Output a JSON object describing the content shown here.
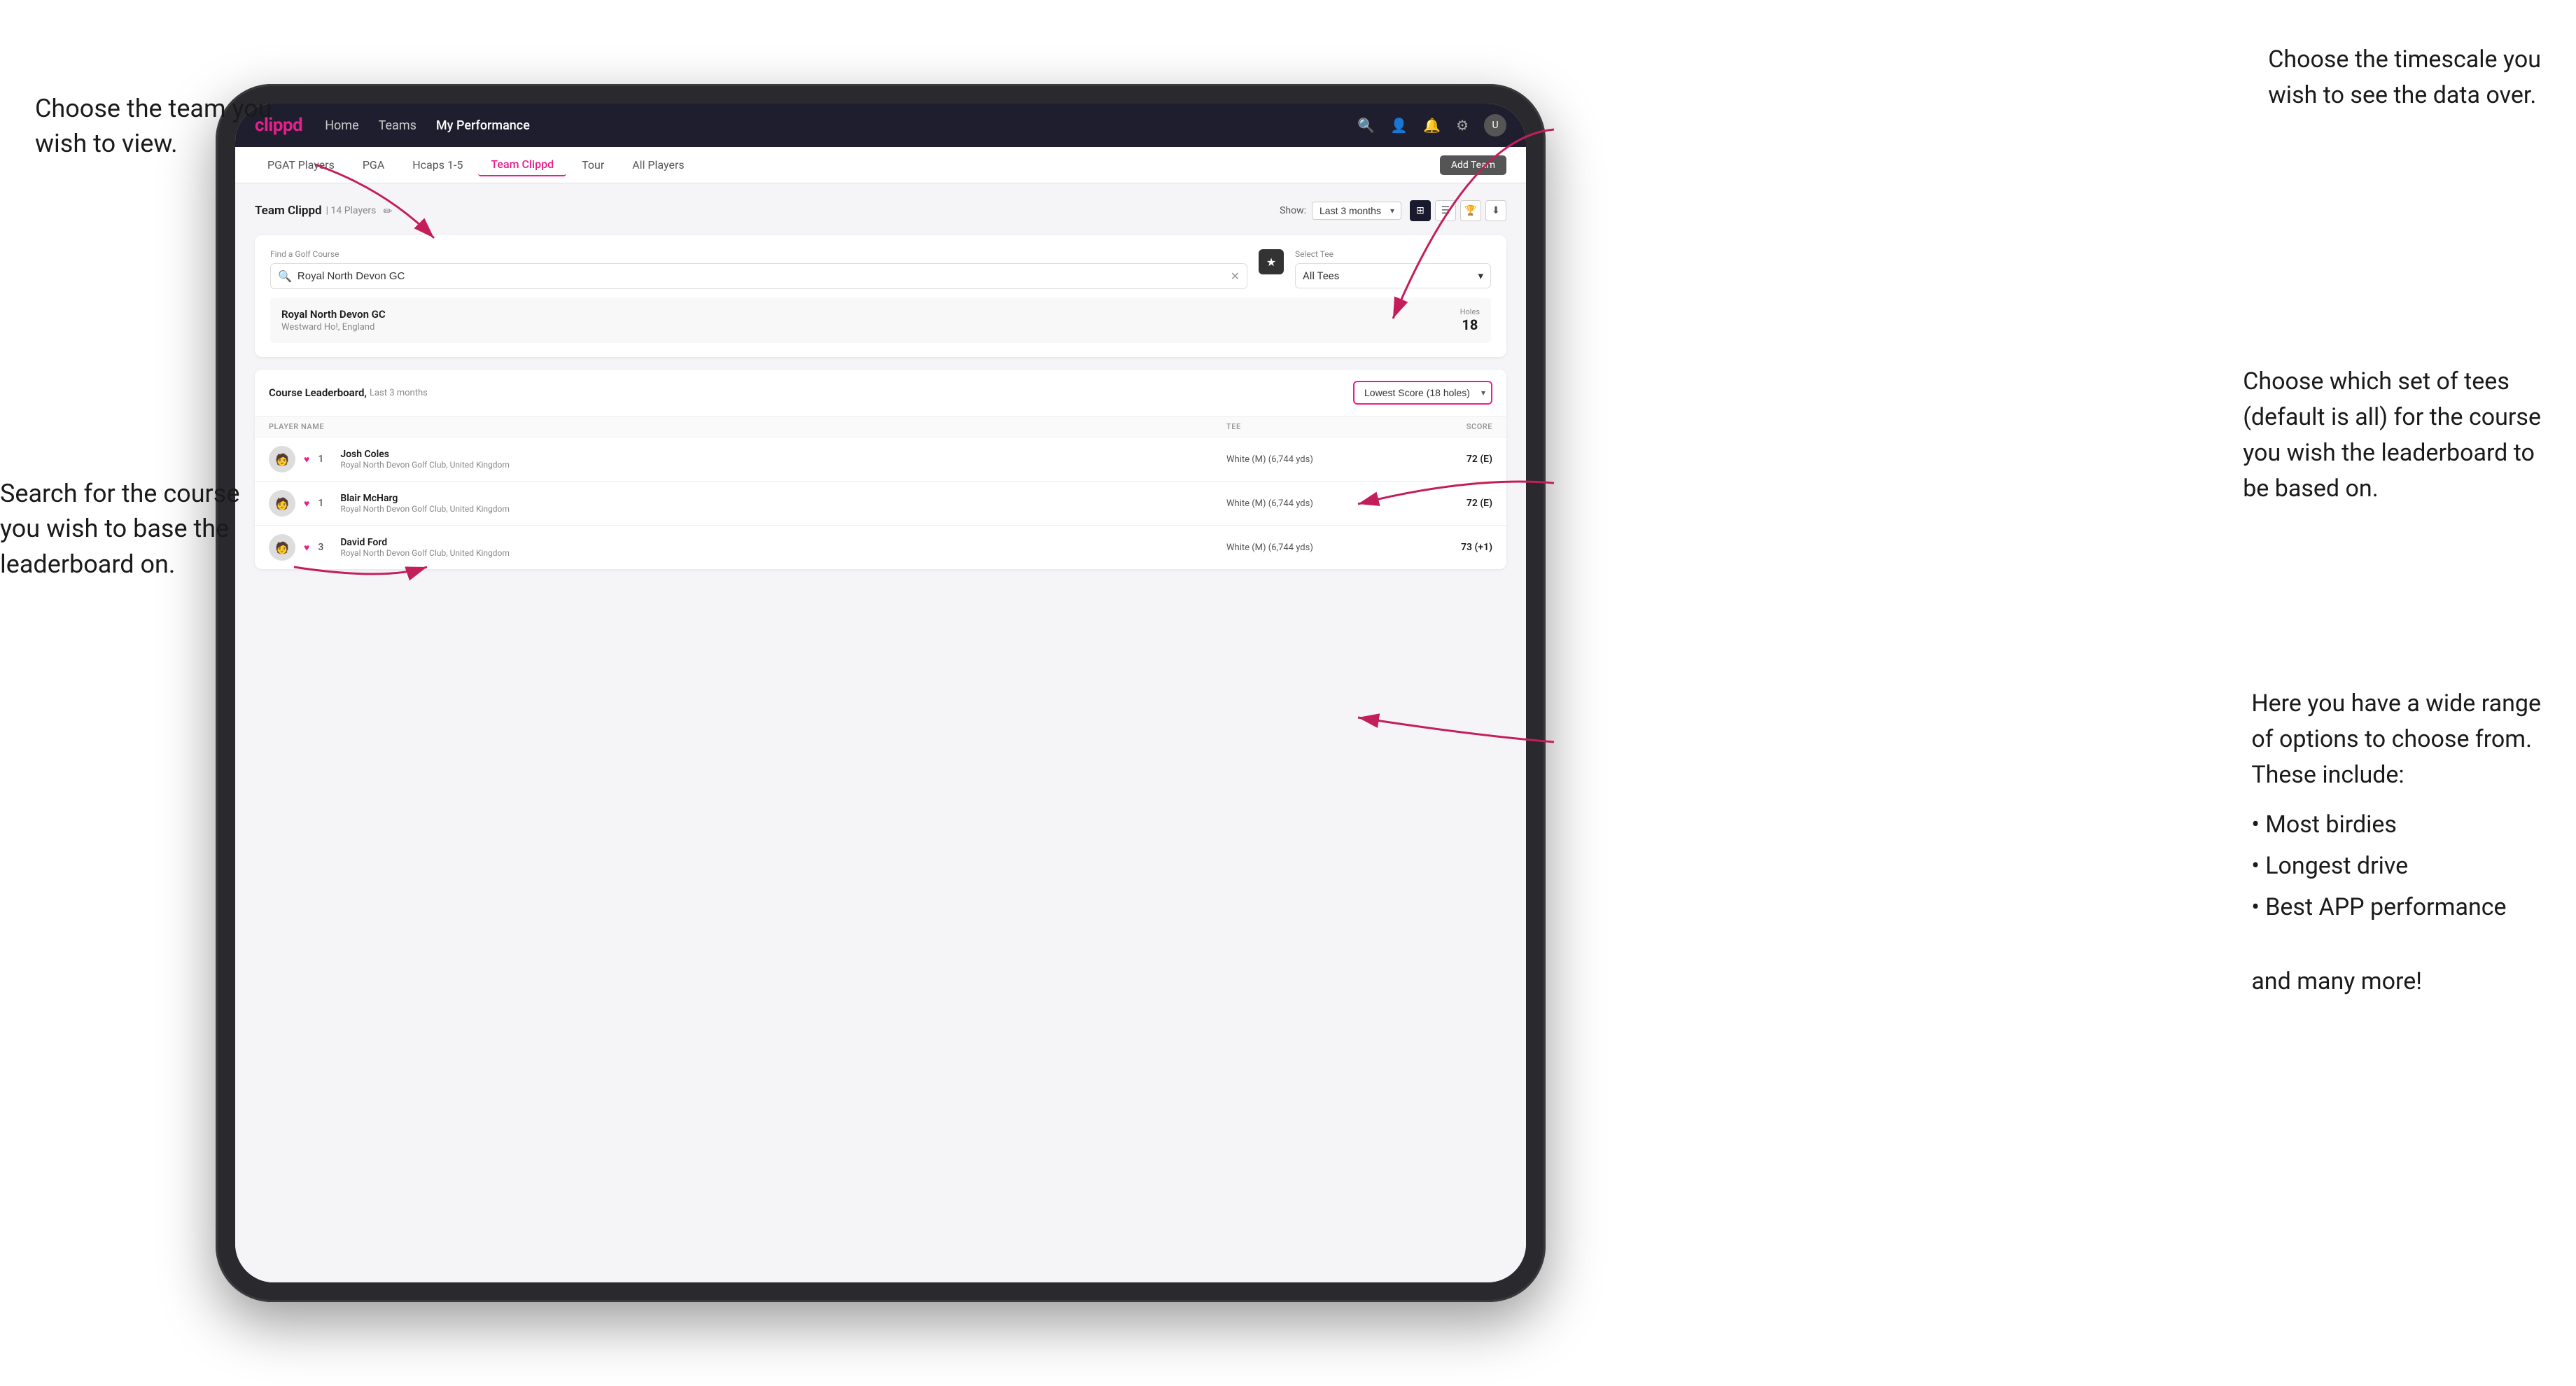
{
  "annotations": {
    "top_left_title": "Choose the team you\nwish to view.",
    "middle_left_title": "Search for the course\nyou wish to base the\nleaderboard on.",
    "top_right_title": "Choose the timescale you\nwish to see the data over.",
    "middle_right_title": "Choose which set of tees\n(default is all) for the course\nyou wish the leaderboard to\nbe based on.",
    "bottom_right_title": "Here you have a wide range\nof options to choose from.\nThese include:",
    "bullet_items": [
      "Most birdies",
      "Longest drive",
      "Best APP performance"
    ],
    "and_more": "and many more!"
  },
  "nav": {
    "logo": "clippd",
    "links": [
      "Home",
      "Teams",
      "My Performance"
    ],
    "active_link": "My Performance"
  },
  "sub_nav": {
    "items": [
      "PGAT Players",
      "PGA",
      "Hcaps 1-5",
      "Team Clippd",
      "Tour",
      "All Players"
    ],
    "active_item": "Team Clippd",
    "add_team_label": "Add Team"
  },
  "team_header": {
    "title": "Team Clippd",
    "player_count": "14 Players",
    "show_label": "Show:",
    "show_value": "Last 3 months"
  },
  "search": {
    "course_label": "Find a Golf Course",
    "course_placeholder": "Royal North Devon GC",
    "tee_label": "Select Tee",
    "tee_value": "All Tees"
  },
  "course_result": {
    "name": "Royal North Devon GC",
    "location": "Westward Ho!, England",
    "holes_label": "Holes",
    "holes_value": "18"
  },
  "leaderboard": {
    "title": "Course Leaderboard,",
    "subtitle": "Last 3 months",
    "score_dropdown": "Lowest Score (18 holes)",
    "columns": {
      "player": "PLAYER NAME",
      "tee": "TEE",
      "score": "SCORE"
    },
    "players": [
      {
        "rank": "1",
        "name": "Josh Coles",
        "club": "Royal North Devon Golf Club, United Kingdom",
        "tee": "White (M) (6,744 yds)",
        "score": "72 (E)"
      },
      {
        "rank": "1",
        "name": "Blair McHarg",
        "club": "Royal North Devon Golf Club, United Kingdom",
        "tee": "White (M) (6,744 yds)",
        "score": "72 (E)"
      },
      {
        "rank": "3",
        "name": "David Ford",
        "club": "Royal North Devon Golf Club, United Kingdom",
        "tee": "White (M) (6,744 yds)",
        "score": "73 (+1)"
      }
    ]
  },
  "icons": {
    "search": "🔍",
    "star": "★",
    "clear": "✕",
    "chevron_down": "▾",
    "grid": "⊞",
    "list": "☰",
    "trophy": "🏆",
    "download": "⬇",
    "bell": "🔔",
    "settings": "⚙",
    "user": "👤",
    "edit": "✏"
  },
  "colors": {
    "brand_pink": "#e91e8c",
    "nav_bg": "#1e1e2e",
    "accent": "#c41e5a"
  }
}
